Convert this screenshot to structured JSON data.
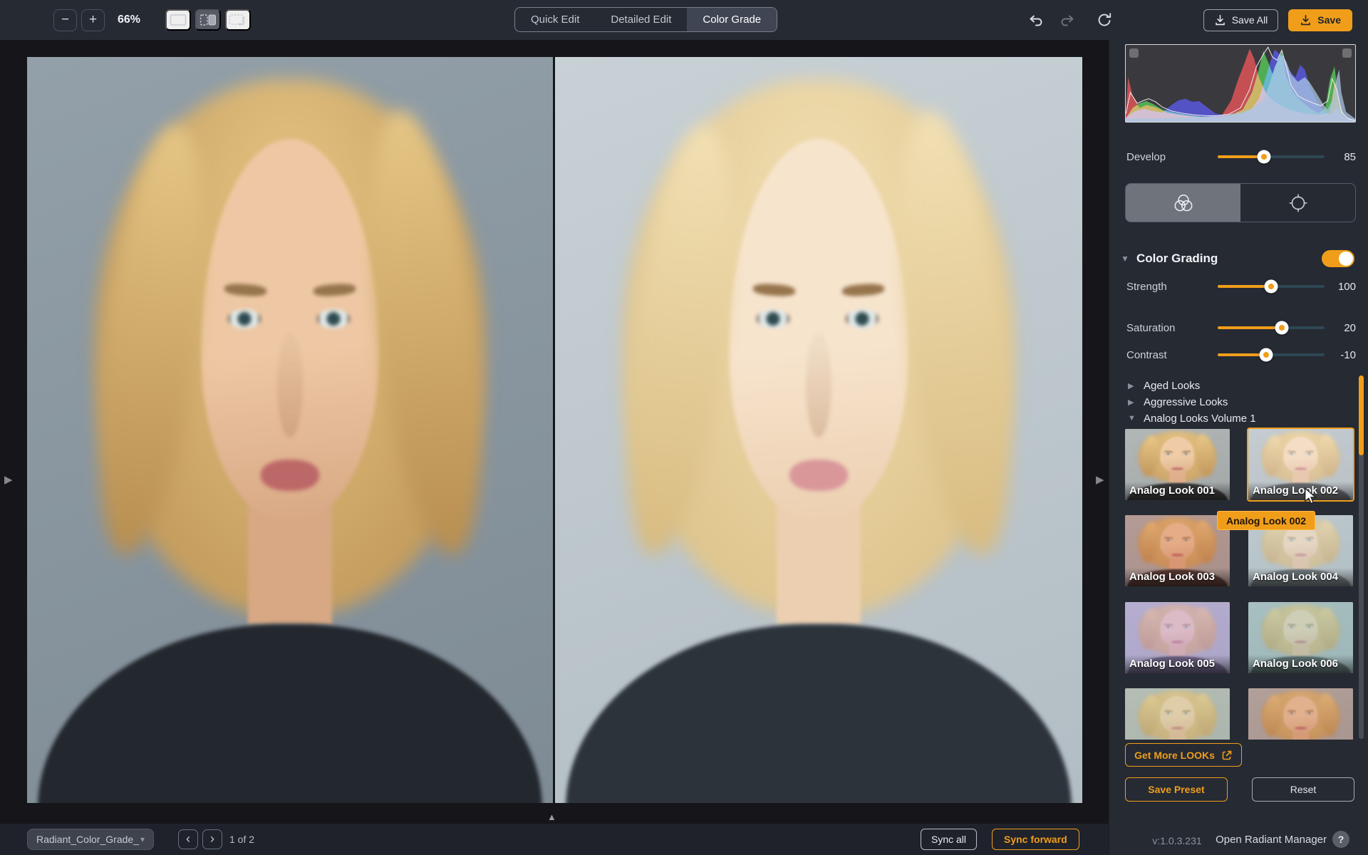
{
  "icons": {
    "minus": "−",
    "plus": "+",
    "caret_down": "▾",
    "tri_right": "▶",
    "tri_down": "▼",
    "tri_up": "▲",
    "chev_left": "‹",
    "chev_right": "›",
    "help": "?"
  },
  "colors": {
    "accent": "#F09E1A",
    "panel_bg": "#262A33",
    "canvas_bg": "#121217",
    "hist_red": "#C82020",
    "hist_green": "#1FA51F",
    "hist_blue": "#2424C8",
    "hist_overlay": "#A9C6E2",
    "hist_line": "#EFEFEF"
  },
  "toolbar": {
    "zoom_level": "66%",
    "tabs": [
      {
        "label": "Quick Edit",
        "active": false
      },
      {
        "label": "Detailed Edit",
        "active": false
      },
      {
        "label": "Color Grade",
        "active": true
      }
    ],
    "save_all_label": "Save All",
    "save_label": "Save"
  },
  "histogram": {
    "type": "area",
    "series": {
      "r": [
        [
          0,
          8
        ],
        [
          1,
          58
        ],
        [
          3,
          34
        ],
        [
          6,
          18
        ],
        [
          9,
          22
        ],
        [
          13,
          19
        ],
        [
          18,
          12
        ],
        [
          24,
          9
        ],
        [
          30,
          7
        ],
        [
          36,
          6
        ],
        [
          42,
          9
        ],
        [
          46,
          28
        ],
        [
          49,
          55
        ],
        [
          52,
          78
        ],
        [
          54,
          95
        ],
        [
          56,
          82
        ],
        [
          58,
          58
        ],
        [
          61,
          38
        ],
        [
          64,
          28
        ],
        [
          68,
          20
        ],
        [
          72,
          15
        ],
        [
          78,
          11
        ],
        [
          84,
          9
        ],
        [
          89,
          12
        ],
        [
          91,
          52
        ],
        [
          93,
          30
        ],
        [
          95,
          8
        ],
        [
          100,
          2
        ]
      ],
      "g": [
        [
          0,
          4
        ],
        [
          3,
          18
        ],
        [
          6,
          24
        ],
        [
          9,
          27
        ],
        [
          12,
          23
        ],
        [
          16,
          16
        ],
        [
          21,
          12
        ],
        [
          27,
          9
        ],
        [
          33,
          7
        ],
        [
          40,
          6
        ],
        [
          46,
          9
        ],
        [
          51,
          16
        ],
        [
          55,
          38
        ],
        [
          58,
          68
        ],
        [
          60,
          92
        ],
        [
          62,
          78
        ],
        [
          64,
          62
        ],
        [
          66,
          78
        ],
        [
          68,
          92
        ],
        [
          70,
          58
        ],
        [
          73,
          38
        ],
        [
          76,
          28
        ],
        [
          80,
          18
        ],
        [
          84,
          11
        ],
        [
          87,
          18
        ],
        [
          89,
          55
        ],
        [
          91,
          72
        ],
        [
          93,
          22
        ],
        [
          96,
          5
        ],
        [
          100,
          2
        ]
      ],
      "b": [
        [
          0,
          6
        ],
        [
          4,
          14
        ],
        [
          8,
          17
        ],
        [
          12,
          14
        ],
        [
          16,
          12
        ],
        [
          20,
          22
        ],
        [
          23,
          28
        ],
        [
          26,
          30
        ],
        [
          29,
          26
        ],
        [
          32,
          27
        ],
        [
          35,
          20
        ],
        [
          39,
          11
        ],
        [
          44,
          8
        ],
        [
          50,
          10
        ],
        [
          55,
          17
        ],
        [
          58,
          30
        ],
        [
          60,
          48
        ],
        [
          63,
          78
        ],
        [
          65,
          94
        ],
        [
          67,
          88
        ],
        [
          69,
          84
        ],
        [
          71,
          68
        ],
        [
          74,
          58
        ],
        [
          76,
          74
        ],
        [
          78,
          68
        ],
        [
          80,
          48
        ],
        [
          83,
          28
        ],
        [
          86,
          14
        ],
        [
          89,
          9
        ],
        [
          92,
          18
        ],
        [
          95,
          7
        ],
        [
          100,
          3
        ]
      ],
      "overlay": [
        [
          0,
          4
        ],
        [
          10,
          4
        ],
        [
          20,
          5
        ],
        [
          30,
          6
        ],
        [
          40,
          8
        ],
        [
          50,
          12
        ],
        [
          55,
          17
        ],
        [
          60,
          28
        ],
        [
          63,
          52
        ],
        [
          65,
          72
        ],
        [
          67,
          84
        ],
        [
          68,
          88
        ],
        [
          70,
          78
        ],
        [
          72,
          62
        ],
        [
          75,
          52
        ],
        [
          78,
          58
        ],
        [
          80,
          52
        ],
        [
          83,
          38
        ],
        [
          86,
          23
        ],
        [
          88,
          16
        ],
        [
          90,
          28
        ],
        [
          92,
          58
        ],
        [
          93,
          68
        ],
        [
          94,
          38
        ],
        [
          96,
          13
        ],
        [
          100,
          4
        ]
      ],
      "luma": [
        [
          0,
          10
        ],
        [
          2,
          38
        ],
        [
          5,
          24
        ],
        [
          8,
          28
        ],
        [
          10,
          30
        ],
        [
          13,
          26
        ],
        [
          16,
          19
        ],
        [
          20,
          14
        ],
        [
          25,
          11
        ],
        [
          30,
          9
        ],
        [
          35,
          8
        ],
        [
          40,
          8
        ],
        [
          45,
          10
        ],
        [
          50,
          18
        ],
        [
          54,
          42
        ],
        [
          57,
          72
        ],
        [
          60,
          88
        ],
        [
          62,
          97
        ],
        [
          64,
          84
        ],
        [
          66,
          80
        ],
        [
          68,
          93
        ],
        [
          70,
          72
        ],
        [
          72,
          48
        ],
        [
          75,
          34
        ],
        [
          78,
          29
        ],
        [
          82,
          24
        ],
        [
          85,
          21
        ],
        [
          88,
          27
        ],
        [
          90,
          56
        ],
        [
          92,
          42
        ],
        [
          94,
          13
        ],
        [
          97,
          4
        ],
        [
          100,
          2
        ]
      ]
    }
  },
  "panel": {
    "develop": {
      "label": "Develop",
      "value": "85",
      "pct": 43
    },
    "color_grading": {
      "title": "Color Grading",
      "enabled": true
    },
    "sliders": [
      {
        "label": "Strength",
        "value": "100",
        "pct": 50
      },
      {
        "label": "Saturation",
        "value": "20",
        "pct": 60
      },
      {
        "label": "Contrast",
        "value": "-10",
        "pct": 45
      }
    ],
    "groups": [
      {
        "label": "Aged Looks",
        "expanded": false
      },
      {
        "label": "Aggressive Looks",
        "expanded": false
      },
      {
        "label": "Analog Looks Volume 1",
        "expanded": true
      }
    ],
    "looks": [
      {
        "label": "Analog Look 001",
        "selected": false,
        "tint": "rgba(235,195,150,0.12)"
      },
      {
        "label": "Analog Look 002",
        "selected": true,
        "tint": "rgba(255,255,255,0.32)"
      },
      {
        "label": "Analog Look 003",
        "selected": false,
        "tint": "rgba(205,95,60,0.30)"
      },
      {
        "label": "Analog Look 004",
        "selected": false,
        "tint": "rgba(215,228,232,0.42)"
      },
      {
        "label": "Analog Look 005",
        "selected": false,
        "tint": "rgba(195,165,230,0.46)"
      },
      {
        "label": "Analog Look 006",
        "selected": false,
        "tint": "rgba(165,205,198,0.44)"
      },
      {
        "label": "",
        "selected": false,
        "tint": "rgba(198,205,170,0.38)"
      },
      {
        "label": "",
        "selected": false,
        "tint": "rgba(195,115,82,0.32)"
      }
    ],
    "tooltip": "Analog Look 002",
    "get_more_label": "Get More LOOKs",
    "save_preset_label": "Save Preset",
    "reset_label": "Reset",
    "version": "v:1.0.3.231",
    "manager_label": "Open Radiant Manager"
  },
  "bottombar": {
    "file_name": "Radiant_Color_Grade_",
    "page_indicator": "1 of 2",
    "sync_all_label": "Sync all",
    "sync_forward_label": "Sync forward"
  }
}
